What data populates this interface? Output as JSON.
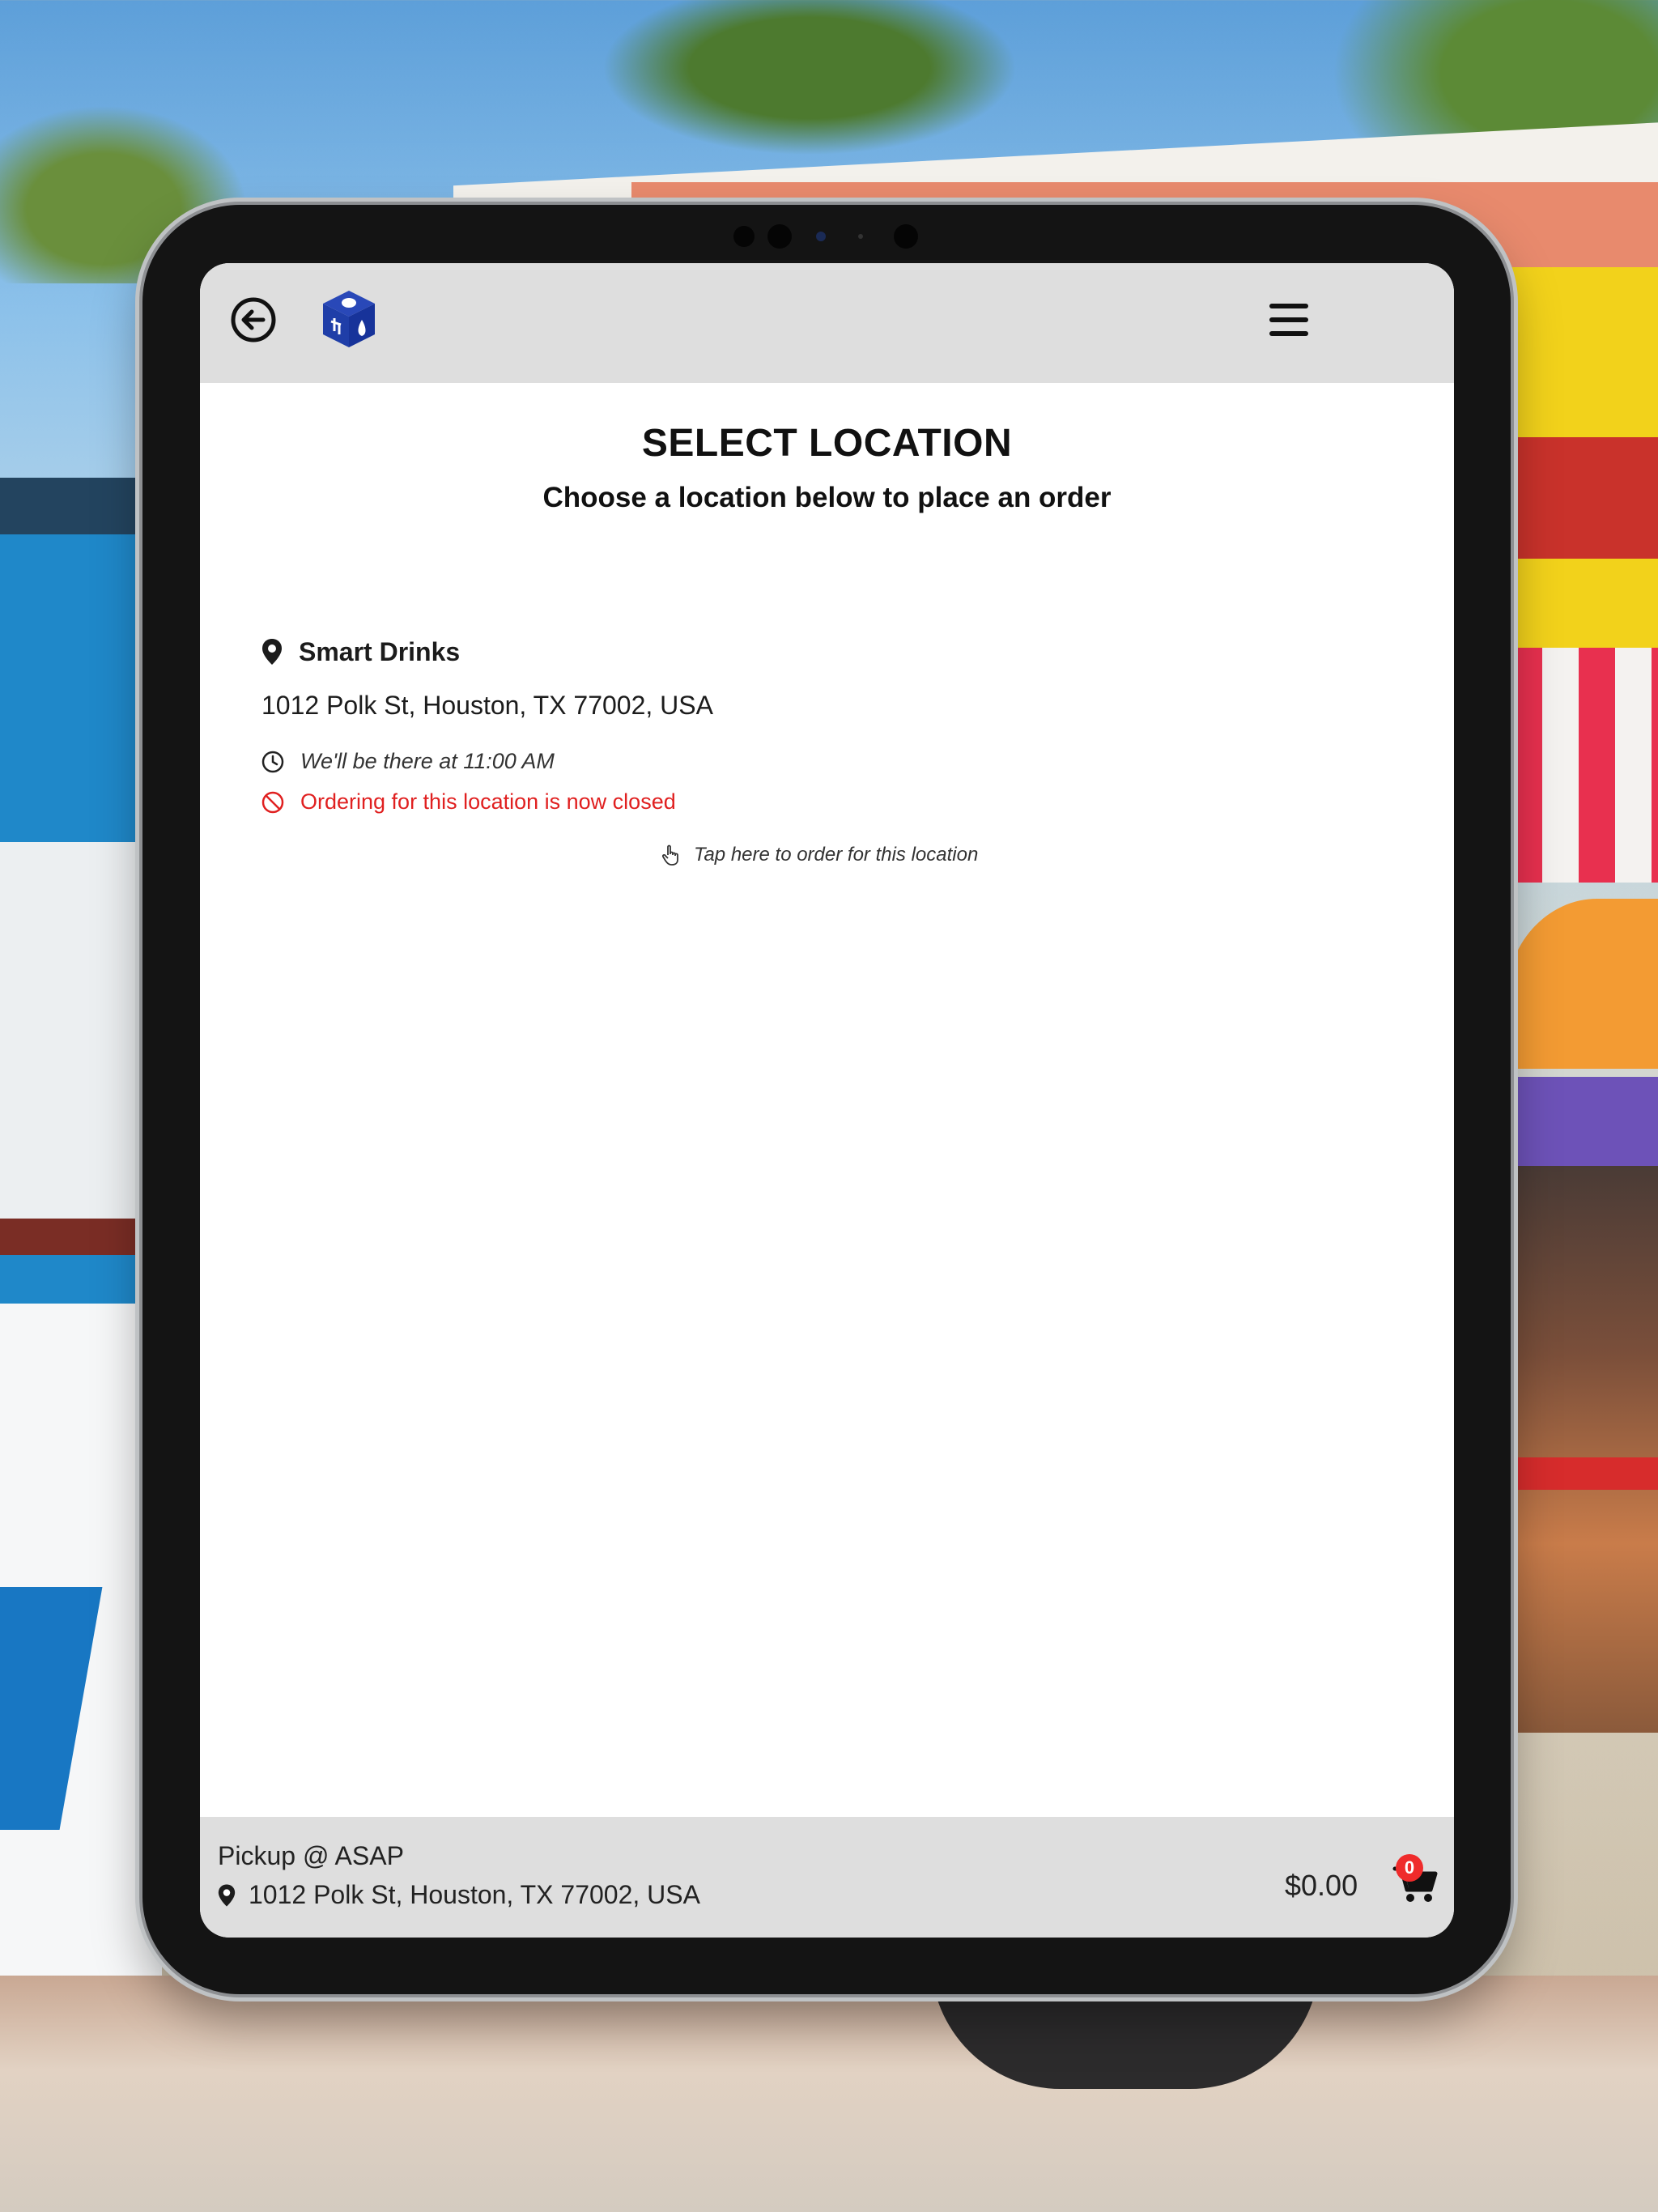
{
  "header": {
    "back_icon": "arrow-left-circle-icon",
    "logo_icon": "brand-cube-logo",
    "menu_icon": "hamburger-menu-icon"
  },
  "page": {
    "title": "SELECT LOCATION",
    "subtitle": "Choose a location below to place an order"
  },
  "locations": [
    {
      "name": "Smart Drinks",
      "address": "1012 Polk St, Houston, TX 77002, USA",
      "time_text": "We'll be there at 11:00 AM",
      "status_text": "Ordering for this location is now closed",
      "tap_text": "Tap here to order for this location"
    }
  ],
  "footer": {
    "pickup_label": "Pickup @ ASAP",
    "address": "1012 Polk St, Houston, TX 77002, USA",
    "cart_total": "$0.00",
    "cart_count": "0"
  },
  "colors": {
    "header_bg": "#dedede",
    "closed_red": "#e02020",
    "badge_red": "#ef2b2b",
    "logo_blue": "#1f3ea8"
  }
}
